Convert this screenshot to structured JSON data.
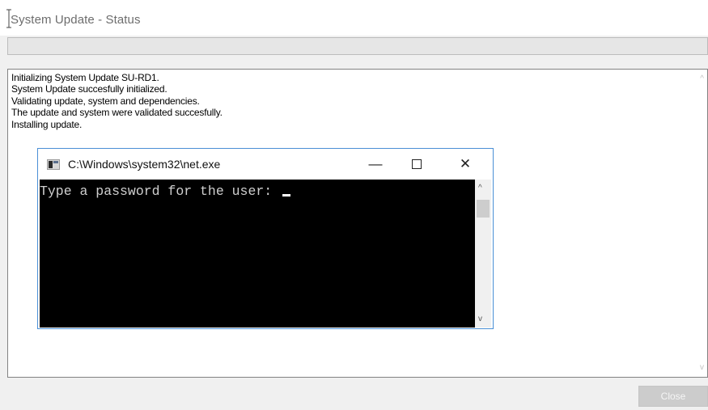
{
  "window": {
    "title": "System Update - Status"
  },
  "log": {
    "lines": [
      "Initializing System Update SU-RD1.",
      "System Update succesfully initialized.",
      "Validating update, system and dependencies.",
      "The update and system were validated succesfully.",
      "Installing update."
    ]
  },
  "console": {
    "title": "C:\\Windows\\system32\\net.exe",
    "prompt": "Type a password for the user: ",
    "minimize_symbol": "—",
    "close_symbol": "✕",
    "scroll_up_symbol": "^",
    "scroll_down_symbol": "v"
  },
  "buttons": {
    "close_label": "Close"
  },
  "icons": {
    "log_scroll_up": "chevron-up-icon",
    "log_scroll_down": "chevron-down-icon",
    "console_app": "console-app-icon"
  }
}
